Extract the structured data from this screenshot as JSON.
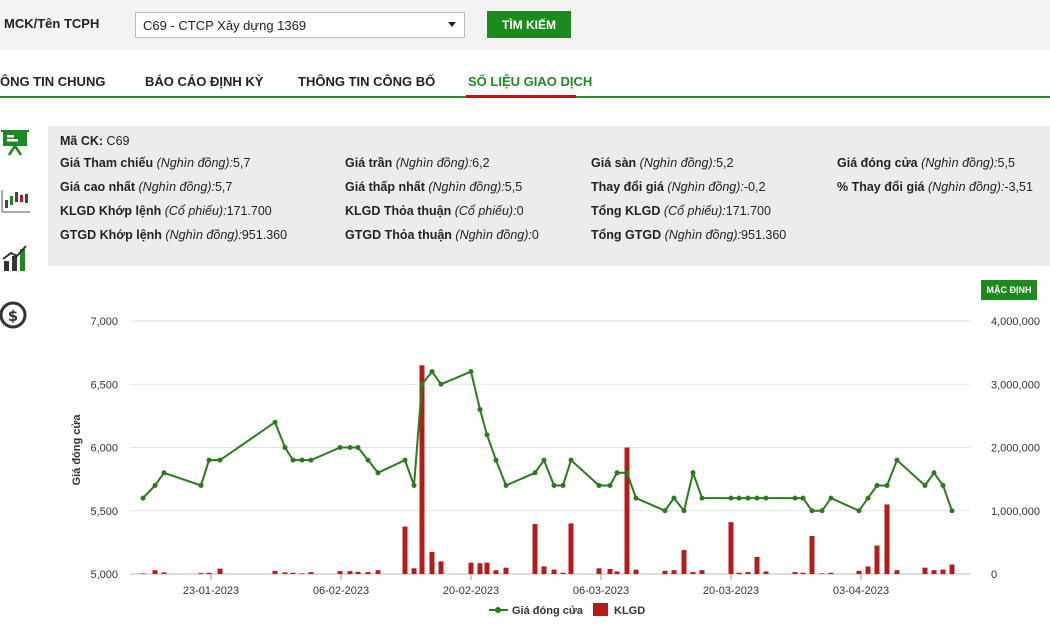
{
  "search": {
    "label": "MCK/Tên TCPH",
    "selected": "C69 - CTCP Xây dựng 1369",
    "button": "TÌM KIẾM"
  },
  "tabs": [
    {
      "label": "ÔNG TIN CHUNG"
    },
    {
      "label": "BÁO CÁO ĐỊNH KỲ"
    },
    {
      "label": "THÔNG TIN CÔNG BỐ"
    },
    {
      "label": "SỐ LIỆU GIAO DỊCH",
      "active": true
    }
  ],
  "side_icons": [
    "presentation-board-icon",
    "candlestick-chart-icon",
    "growth-chart-icon",
    "dollar-coin-icon"
  ],
  "info": {
    "ma_ck": {
      "label": "Mã CK:",
      "value": "C69"
    },
    "rows": [
      [
        {
          "label": "Giá Tham chiếu",
          "unit": "(Nghìn đồng):",
          "value": "5,7"
        },
        {
          "label": "Giá trần",
          "unit": "(Nghìn đồng):",
          "value": "6,2"
        },
        {
          "label": "Giá sàn",
          "unit": "(Nghìn đồng):",
          "value": "5,2"
        },
        {
          "label": "Giá đóng cửa",
          "unit": "(Nghìn đồng):",
          "value": "5,5"
        }
      ],
      [
        {
          "label": "Giá cao nhất",
          "unit": "(Nghìn đồng):",
          "value": "5,7"
        },
        {
          "label": "Giá thấp nhất",
          "unit": "(Nghìn đồng):",
          "value": "5,5"
        },
        {
          "label": "Thay đổi giá",
          "unit": "(Nghìn đồng):",
          "value": "-0,2"
        },
        {
          "label": "% Thay đổi giá",
          "unit": "(Nghìn đồng):",
          "value": "-3,51"
        }
      ],
      [
        {
          "label": "KLGD Khớp lệnh",
          "unit": "(Cổ phiếu):",
          "value": "171.700"
        },
        {
          "label": "KLGD Thỏa thuận",
          "unit": "(Cổ phiếu):",
          "value": "0"
        },
        {
          "label": "Tổng KLGD",
          "unit": "(Cổ phiếu):",
          "value": "171.700"
        }
      ],
      [
        {
          "label": "GTGD Khớp lệnh",
          "unit": "(Nghìn đồng):",
          "value": "951.360"
        },
        {
          "label": "GTGD Thỏa thuận",
          "unit": "(Nghìn đồng):",
          "value": "0"
        },
        {
          "label": "Tổng GTGD",
          "unit": "(Nghìn đồng):",
          "value": "951.360"
        }
      ]
    ]
  },
  "chart_controls": {
    "default_button": "MẶC ĐỊNH"
  },
  "colors": {
    "accent": "#1d8a1d",
    "price_line": "#2b7a1e",
    "volume_bar": "#b41c1c",
    "active_tab_underline": "#c3121c"
  },
  "chart_data": {
    "type": "line+bar",
    "ylabel": "Giá đóng cửa",
    "y_left": {
      "ticks": [
        "5,000",
        "5,500",
        "6,000",
        "6,500",
        "7,000"
      ],
      "range": [
        5000,
        7000
      ]
    },
    "y_right": {
      "ticks": [
        "0",
        "1,000,000",
        "2,000,000",
        "3,000,000",
        "4,000,000"
      ],
      "range": [
        0,
        4000000
      ]
    },
    "x_ticks": [
      "23-01-2023",
      "06-02-2023",
      "20-02-2023",
      "06-03-2023",
      "20-03-2023",
      "03-04-2023"
    ],
    "legend": [
      "Giá đóng cửa",
      "KLGD"
    ],
    "series": [
      {
        "name": "Giá đóng cửa",
        "values": [
          5600,
          5700,
          5800,
          5700,
          5900,
          5900,
          6200,
          6000,
          5900,
          5900,
          5900,
          6000,
          6000,
          6000,
          5900,
          5800,
          5900,
          5700,
          6500,
          6600,
          6500,
          6600,
          6300,
          6100,
          5900,
          5700,
          5800,
          5900,
          5700,
          5700,
          5900,
          5700,
          5700,
          5800,
          5800,
          5600,
          5500,
          5600,
          5500,
          5800,
          5600,
          5600,
          5600,
          5600,
          5600,
          5600,
          5600,
          5600,
          5500,
          5500,
          5600,
          5500,
          5600,
          5700,
          5700,
          5900,
          5700,
          5800,
          5700,
          5500
        ]
      },
      {
        "name": "KLGD",
        "values": [
          10000,
          60000,
          25000,
          15000,
          20000,
          85000,
          50000,
          25000,
          20000,
          10000,
          30000,
          45000,
          45000,
          35000,
          30000,
          60000,
          750000,
          90000,
          3300000,
          350000,
          200000,
          180000,
          170000,
          180000,
          60000,
          100000,
          790000,
          120000,
          70000,
          20000,
          800000,
          90000,
          80000,
          40000,
          2000000,
          70000,
          50000,
          60000,
          380000,
          30000,
          60000,
          820000,
          20000,
          30000,
          270000,
          40000,
          30000,
          20000,
          600000,
          10000,
          20000,
          50000,
          120000,
          450000,
          1100000,
          60000,
          100000,
          60000,
          70000,
          150000
        ]
      }
    ],
    "volume_x": [
      143,
      155,
      164,
      201,
      209,
      220,
      275,
      285,
      293,
      302,
      311,
      340,
      350,
      358,
      368,
      378,
      405,
      414,
      422,
      432,
      441,
      471,
      480,
      487,
      496,
      506,
      535,
      544,
      554,
      563,
      571,
      599,
      610,
      617,
      627,
      636,
      665,
      674,
      684,
      693,
      702,
      731,
      739,
      748,
      757,
      766,
      795,
      803,
      812,
      822,
      831,
      859,
      868,
      877,
      887,
      897,
      925,
      934,
      943,
      952
    ]
  }
}
